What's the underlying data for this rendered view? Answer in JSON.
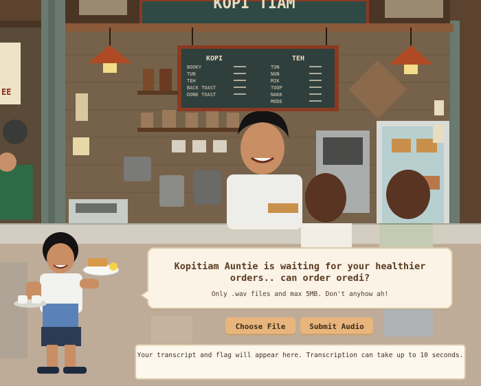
{
  "scene": {
    "menu_board": {
      "col1_title": "KOPI",
      "col2_title": "TEH",
      "col1_items": [
        "BOOKY",
        "TUN",
        "TEH",
        "BACK TOAST",
        "DONE TOAST"
      ],
      "col2_items": [
        "TUN",
        "NUN",
        "MIK",
        "TOOP",
        "NAKK",
        "MODE"
      ]
    },
    "sign_text": "KOPI TIAM",
    "side_sign": "EE"
  },
  "dialog": {
    "headline": "Kopitiam Auntie is waiting for your healthier orders.. can order oredi?",
    "subline": "Only .wav files and max 5MB. Don't anyhow ah!"
  },
  "buttons": {
    "choose_file": "Choose File",
    "submit_audio": "Submit Audio"
  },
  "transcript": {
    "placeholder": "Your transcript and flag will appear here. Transcription can take up to 10 seconds."
  },
  "colors": {
    "button_bg": "#e8b57c",
    "headline": "#5a3a22",
    "panel": "#fbf3e6",
    "border": "#d8c7a8"
  }
}
